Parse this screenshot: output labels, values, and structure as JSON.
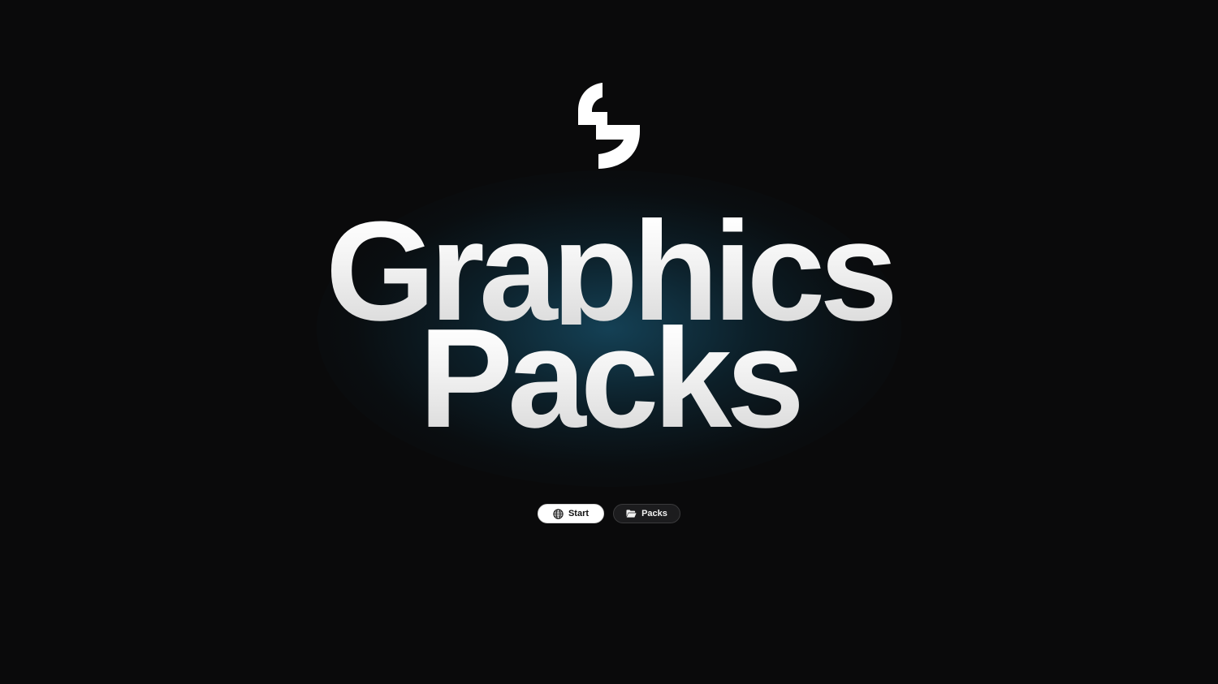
{
  "logo": {
    "icon": "brand-s-logo",
    "color": "#ffffff"
  },
  "hero": {
    "line1": "Graphics",
    "line2": "Packs",
    "glow_color": "#164a62"
  },
  "nav": {
    "start": {
      "label": "Start",
      "icon": "globe-icon"
    },
    "packs": {
      "label": "Packs",
      "icon": "folder-open-icon"
    }
  },
  "colors": {
    "background": "#0a0a0b",
    "text": "#f2f2f2",
    "primary_button_bg": "#ffffff",
    "secondary_button_bg": "#1c1c1e"
  }
}
